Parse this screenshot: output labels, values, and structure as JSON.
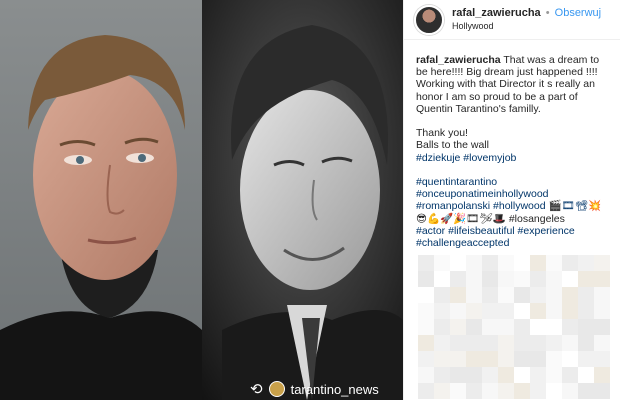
{
  "post": {
    "username": "rafal_zawierucha",
    "separator": "•",
    "follow_label": "Obserwuj",
    "location": "Hollywood",
    "caption_lines": [
      "That was a dream to be here!!!! Big dream just happened !!!! Working with that Director it s really an honor I am so proud to be a part of Quentin Tarantino's familly.",
      "",
      "Thank you!",
      "Balls to the wall"
    ],
    "tags_block1": "#dziekuje #lovemyjob",
    "tags_block2": [
      "#quentintarantino",
      "#onceuponatimeinhollywood",
      "#romanpolanski #hollywood 🎬🎞📽💥",
      "😎💪🚀🎉🎞🛩🎩 #losangeles",
      "#actor #lifeisbeautiful #experience",
      "#challengeaccepted"
    ]
  },
  "repost": {
    "icon": "repost-icon",
    "account": "tarantino_news"
  },
  "colors": {
    "link": "#003569",
    "follow": "#3897f0",
    "border": "#efefef"
  }
}
